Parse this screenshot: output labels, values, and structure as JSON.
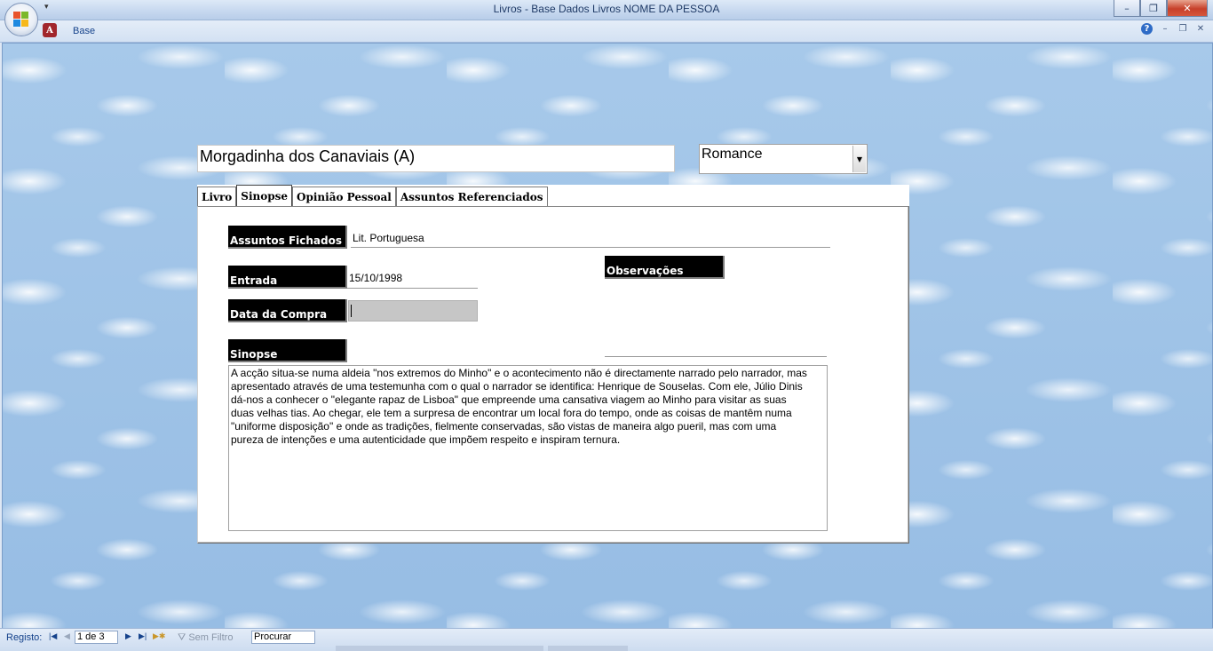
{
  "window": {
    "title": "Livros - Base Dados Livros NOME DA PESSOA",
    "controls": {
      "minimize": "–",
      "restore": "❐",
      "close": "✕"
    }
  },
  "quick_access": {
    "customize": "▾"
  },
  "ribbon": {
    "app_icon": "access-icon",
    "tab_label": "Base",
    "help": "?",
    "minimize": "–",
    "restore": "❐",
    "close": "✕"
  },
  "form": {
    "book_title": "Morgadinha dos Canaviais (A)",
    "genre": "Romance",
    "genre_dropdown_glyph": "▼",
    "tabs": [
      {
        "label": "Livro"
      },
      {
        "label": "Sinopse"
      },
      {
        "label": "Opinião Pessoal"
      },
      {
        "label": "Assuntos Referenciados"
      }
    ],
    "active_tab": "Sinopse",
    "fields": {
      "assuntos_label": "Assuntos Fichados",
      "assuntos_value": "Lit. Portuguesa",
      "entrada_label": "Entrada",
      "entrada_value": "15/10/1998",
      "data_compra_label": "Data da Compra",
      "data_compra_value": "",
      "observacoes_label": "Observações",
      "observacoes_value": "",
      "sinopse_label": "Sinopse",
      "sinopse_text": "A acção situa-se numa aldeia \"nos extremos do Minho\" e o acontecimento não é directamente narrado pelo narrador, mas apresentado através de uma testemunha com o qual o narrador se identifica: Henrique de Souselas. Com ele, Júlio Dinis dá-nos a conhecer o \"elegante rapaz de Lisboa\" que empreende uma cansativa viagem ao Minho para visitar as suas duas velhas tias. Ao chegar, ele tem a surpresa de encontrar um local fora do tempo, onde as coisas de mantêm numa \"uniforme disposição\" e onde as tradições, fielmente conservadas, são vistas de maneira algo pueril, mas com uma pureza de intenções e uma autenticidade que impõem respeito e inspiram ternura."
    }
  },
  "statusbar": {
    "record_label": "Registo:",
    "first": "|◀",
    "prev": "◀",
    "record_position": "1 de 3",
    "next": "▶",
    "last": "▶|",
    "new": "▶✱",
    "filter_icon": "funnel-icon",
    "filter_label": "Sem Filtro",
    "search_text": "Procurar"
  }
}
